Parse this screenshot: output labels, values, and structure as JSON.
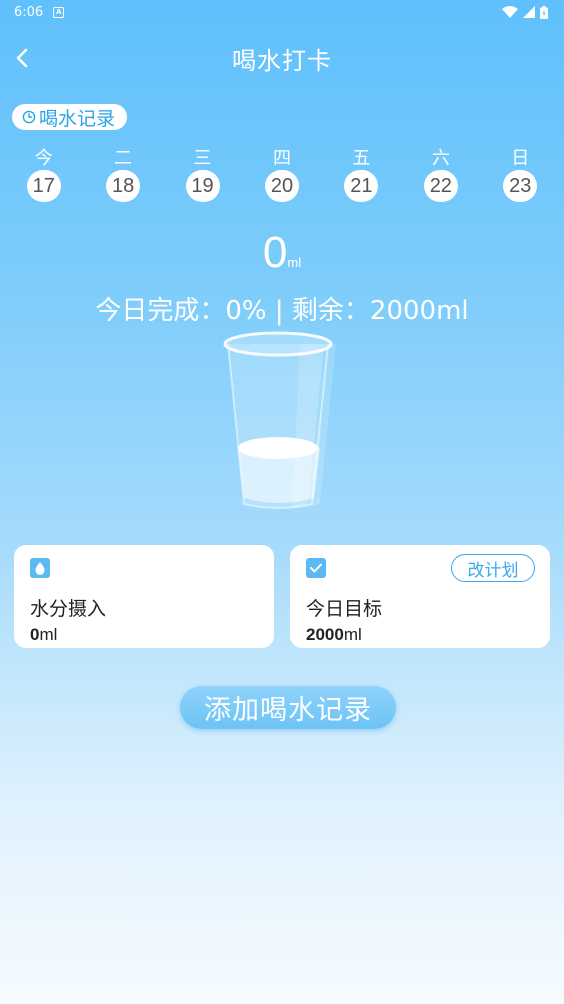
{
  "status_bar": {
    "time": "6:06",
    "notification_icon": "A"
  },
  "header": {
    "title": "喝水打卡",
    "back_icon": "chevron-left-icon"
  },
  "record_pill": {
    "label": "喝水记录",
    "icon": "clock-icon"
  },
  "week": [
    {
      "label": "今",
      "date": "17"
    },
    {
      "label": "二",
      "date": "18"
    },
    {
      "label": "三",
      "date": "19"
    },
    {
      "label": "四",
      "date": "20"
    },
    {
      "label": "五",
      "date": "21"
    },
    {
      "label": "六",
      "date": "22"
    },
    {
      "label": "日",
      "date": "23"
    }
  ],
  "intake": {
    "amount": "0",
    "unit": "ml"
  },
  "summary": "今日完成：0% | 剩余：2000ml",
  "cards": {
    "water": {
      "title": "水分摄入",
      "value": "0",
      "unit": "ml",
      "icon": "water-drop-icon"
    },
    "goal": {
      "title": "今日目标",
      "value": "2000",
      "unit": "ml",
      "icon": "checkbox-icon",
      "button": "改计划"
    }
  },
  "add_button": "添加喝水记录",
  "colors": {
    "accent": "#2ba3ea",
    "card_icon": "#5bb9f3",
    "background_top": "#5fc0fb"
  }
}
